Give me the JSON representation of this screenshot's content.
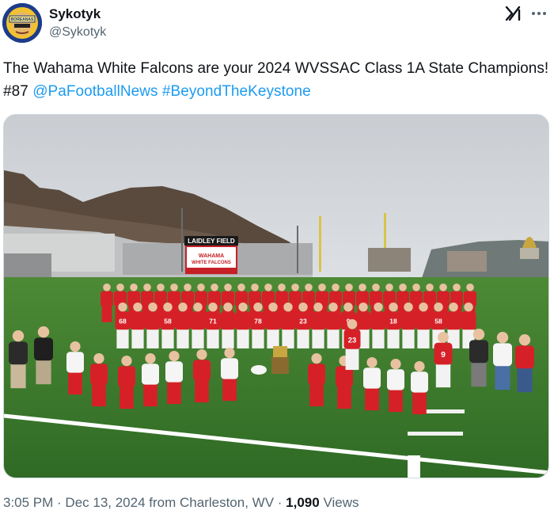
{
  "author": {
    "display_name": "Sykotyk",
    "handle": "@Sykotyk",
    "avatar_text": "BOREANAS"
  },
  "header_icons": {
    "grok": "grok-icon",
    "more": "more-icon"
  },
  "tweet": {
    "text": "The Wahama White Falcons are your 2024 WVSSAC Class 1A State Champions! #87 ",
    "mention": "@PaFootballNews",
    "space": " ",
    "hashtag": "#BeyondTheKeystone"
  },
  "photo": {
    "field_sign_title": "LAIDLEY FIELD",
    "banner_line1": "WAHAMA",
    "banner_line2": "WHITE FALCONS",
    "jersey_numbers": [
      "68",
      "58",
      "71",
      "78",
      "23",
      "9",
      "18",
      "58",
      "14",
      "55"
    ]
  },
  "meta": {
    "time": "3:05 PM",
    "separator1": " · ",
    "date": "Dec 13, 2024",
    "location": " from Charleston, WV",
    "separator2": " · ",
    "views_count": "1,090",
    "views_label": " Views"
  },
  "colors": {
    "link": "#1d9bf0",
    "secondary_text": "#536471",
    "jersey_red": "#d62027",
    "field_green": "#3f7a2e"
  }
}
